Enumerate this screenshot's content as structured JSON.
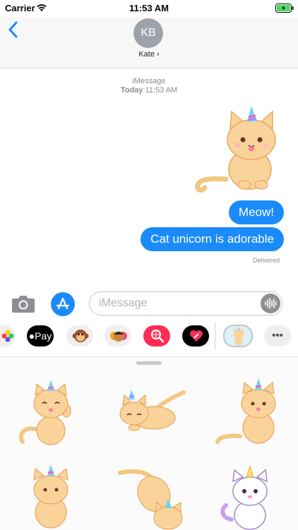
{
  "status_bar": {
    "carrier": "Carrier",
    "time": "11:53 AM"
  },
  "header": {
    "avatar_initials": "KB",
    "contact_name": "Kate ›"
  },
  "conversation": {
    "service": "iMessage",
    "timestamp_day": "Today",
    "timestamp_time": "11:53 AM",
    "messages": [
      {
        "text": "Meow!"
      },
      {
        "text": "Cat unicorn is adorable"
      }
    ],
    "delivery_status": "Delivered"
  },
  "composer": {
    "placeholder": "iMessage"
  },
  "app_drawer": {
    "apple_pay_label": "Pay",
    "more_label": "•••"
  },
  "colors": {
    "bubble": "#1b8bfb",
    "accent": "#1b8bfb",
    "battery": "#4cd964"
  }
}
